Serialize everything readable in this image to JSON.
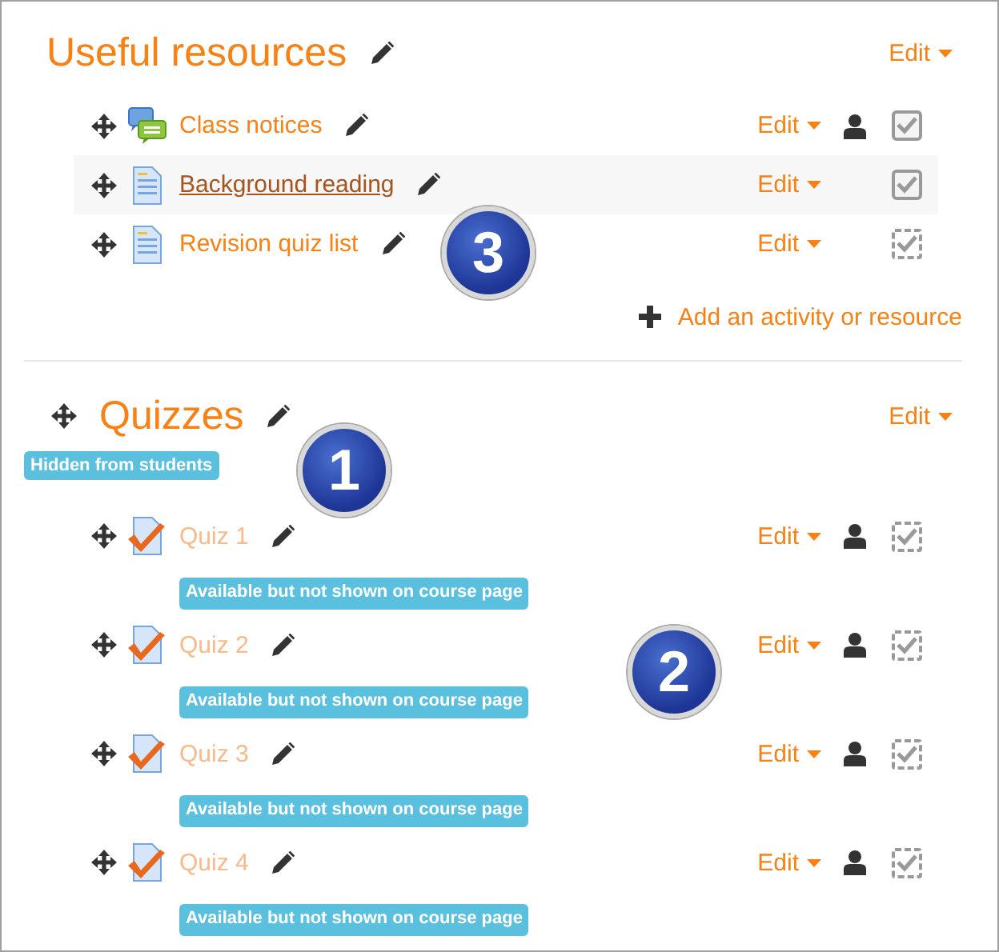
{
  "sections": [
    {
      "title": "Useful resources",
      "movable": false,
      "edit": "Edit",
      "add_link": "Add an activity or resource",
      "activities": [
        {
          "kind": "forum",
          "name": "Class notices",
          "edit": "Edit",
          "highlighted": false,
          "dimmed": false,
          "group_mode": true,
          "auto_completion": false
        },
        {
          "kind": "page",
          "name": "Background reading",
          "edit": "Edit",
          "highlighted": true,
          "dimmed": false,
          "group_mode": false,
          "auto_completion": false
        },
        {
          "kind": "page",
          "name": "Revision quiz list",
          "edit": "Edit",
          "highlighted": false,
          "dimmed": false,
          "group_mode": false,
          "auto_completion": true,
          "callout": "3"
        }
      ]
    },
    {
      "title": "Quizzes",
      "movable": true,
      "edit": "Edit",
      "availability": "Hidden from students",
      "callout": "1",
      "activities": [
        {
          "kind": "quiz",
          "name": "Quiz 1",
          "edit": "Edit",
          "highlighted": false,
          "dimmed": true,
          "group_mode": true,
          "auto_completion": true,
          "availability": "Available but not shown on course page"
        },
        {
          "kind": "quiz",
          "name": "Quiz 2",
          "edit": "Edit",
          "highlighted": false,
          "dimmed": true,
          "group_mode": true,
          "auto_completion": true,
          "availability": "Available but not shown on course page",
          "callout": "2"
        },
        {
          "kind": "quiz",
          "name": "Quiz 3",
          "edit": "Edit",
          "highlighted": false,
          "dimmed": true,
          "group_mode": true,
          "auto_completion": true,
          "availability": "Available but not shown on course page"
        },
        {
          "kind": "quiz",
          "name": "Quiz 4",
          "edit": "Edit",
          "highlighted": false,
          "dimmed": true,
          "group_mode": true,
          "auto_completion": true,
          "availability": "Available but not shown on course page"
        }
      ]
    }
  ]
}
